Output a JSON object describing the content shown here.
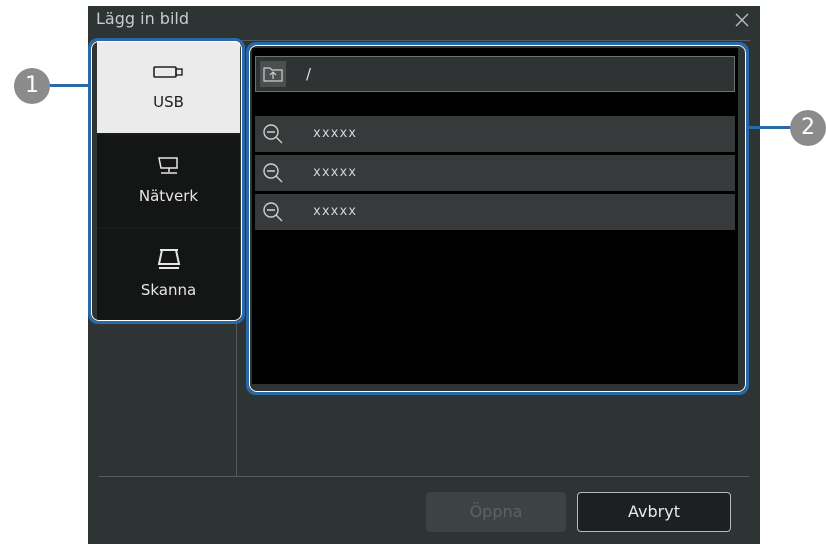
{
  "dialog": {
    "title": "Lägg in bild",
    "close_icon": "close-icon"
  },
  "sources": [
    {
      "label": "USB",
      "icon": "usb-icon",
      "active": true
    },
    {
      "label": "Nätverk",
      "icon": "network-icon",
      "active": false
    },
    {
      "label": "Skanna",
      "icon": "scanner-icon",
      "active": false
    }
  ],
  "browser": {
    "path": "/",
    "path_icon": "folder-up-icon",
    "files": [
      {
        "name": "xxxxx",
        "icon": "zoom-out-icon"
      },
      {
        "name": "xxxxx",
        "icon": "zoom-out-icon"
      },
      {
        "name": "xxxxx",
        "icon": "zoom-out-icon"
      }
    ]
  },
  "buttons": {
    "open_label": "Öppna",
    "cancel_label": "Avbryt"
  },
  "callouts": [
    "1",
    "2"
  ],
  "colors": {
    "highlight": "#2a69a8",
    "dialog_bg": "#2e3333"
  }
}
